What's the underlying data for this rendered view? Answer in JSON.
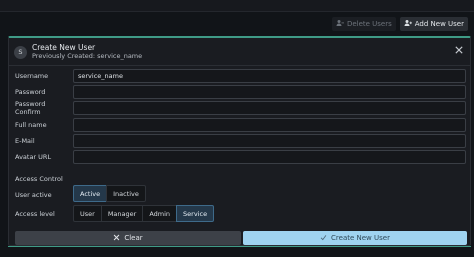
{
  "toolbar": {
    "delete_label": "Delete Users",
    "add_label": "Add New User"
  },
  "dialog": {
    "avatar_letter": "S",
    "title": "Create New User",
    "subtitle": "Previously Created: service_name"
  },
  "form": {
    "fields": [
      {
        "label": "Username",
        "value": "service_name"
      },
      {
        "label": "Password",
        "value": ""
      },
      {
        "label": "Password Confirm",
        "value": ""
      },
      {
        "label": "Full name",
        "value": ""
      },
      {
        "label": "E-Mail",
        "value": ""
      },
      {
        "label": "Avatar URL",
        "value": ""
      }
    ],
    "access_control_label": "Access Control",
    "user_active": {
      "label": "User active",
      "options": [
        "Active",
        "Inactive"
      ],
      "selected": "Active"
    },
    "access_level": {
      "label": "Access level",
      "options": [
        "User",
        "Manager",
        "Admin",
        "Service"
      ],
      "selected": "Service"
    }
  },
  "actions": {
    "clear_label": "Clear",
    "create_label": "Create New User"
  },
  "colors": {
    "accent": "#3f9b86",
    "selected": "#24384a",
    "primary_button": "#9fd3f0"
  },
  "icons": [
    "user-minus-icon",
    "user-plus-icon",
    "close-icon",
    "x-icon",
    "check-icon"
  ]
}
